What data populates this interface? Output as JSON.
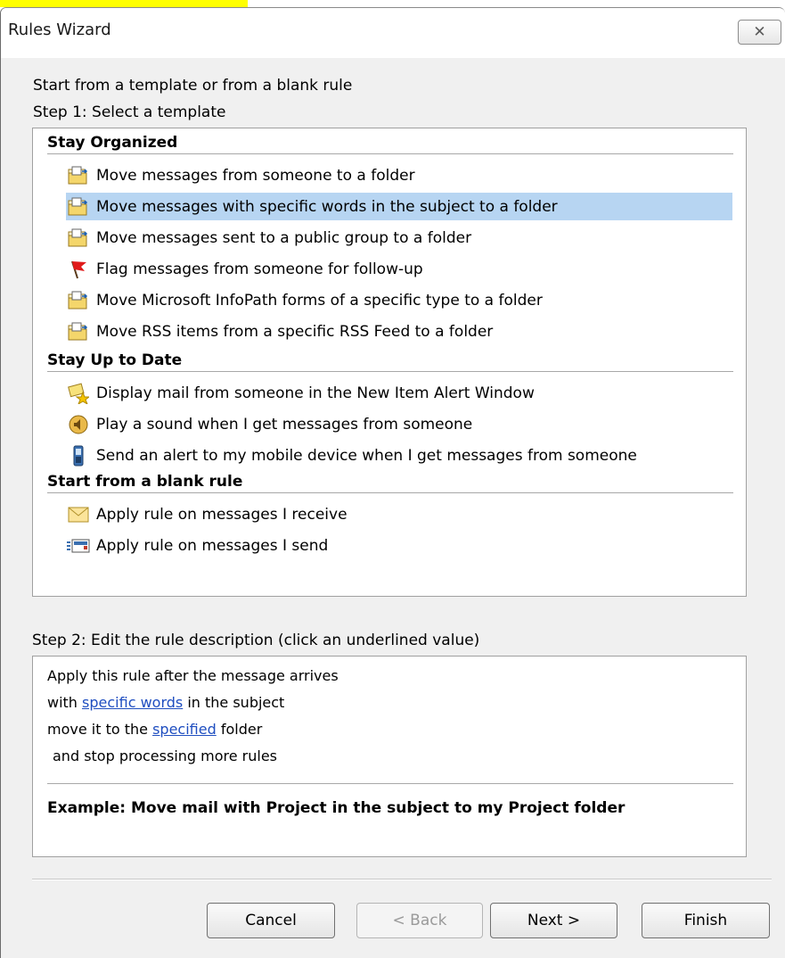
{
  "window": {
    "title": "Rules Wizard",
    "close_label": "✕"
  },
  "intro": "Start from a template or from a blank rule",
  "step1": "Step 1: Select a template",
  "groups": [
    {
      "label": "Stay Organized",
      "items": [
        {
          "label": "Move messages from someone to a folder",
          "icon": "move-to-folder-icon"
        },
        {
          "label": "Move messages with specific words in the subject to a folder",
          "icon": "move-to-folder-icon",
          "selected": true
        },
        {
          "label": "Move messages sent to a public group to a folder",
          "icon": "move-to-folder-icon"
        },
        {
          "label": "Flag messages from someone for follow-up",
          "icon": "red-flag-icon"
        },
        {
          "label": "Move Microsoft InfoPath forms of a specific type to a folder",
          "icon": "move-to-folder-icon"
        },
        {
          "label": "Move RSS items from a specific RSS Feed to a folder",
          "icon": "move-to-folder-icon"
        }
      ]
    },
    {
      "label": "Stay Up to Date",
      "items": [
        {
          "label": "Display mail from someone in the New Item Alert Window",
          "icon": "new-item-alert-icon"
        },
        {
          "label": "Play a sound when I get messages from someone",
          "icon": "sound-icon"
        },
        {
          "label": "Send an alert to my mobile device when I get messages from someone",
          "icon": "mobile-device-icon"
        }
      ]
    },
    {
      "label": "Start from a blank rule",
      "items": [
        {
          "label": "Apply rule on messages I receive",
          "icon": "envelope-icon"
        },
        {
          "label": "Apply rule on messages I send",
          "icon": "send-mail-icon"
        }
      ]
    }
  ],
  "step2": "Step 2: Edit the rule description (click an underlined value)",
  "description": {
    "line1": "Apply this rule after the message arrives",
    "line2_pre": "with ",
    "line2_link": "specific words",
    "line2_post": " in the subject",
    "line3_pre": "move it to the ",
    "line3_link": "specified",
    "line3_post": " folder",
    "line4": "and stop processing more rules",
    "example": "Example: Move mail with Project in the subject to my Project folder"
  },
  "buttons": {
    "cancel": "Cancel",
    "back": "< Back",
    "next": "Next >",
    "finish": "Finish"
  },
  "colors": {
    "selection": "#b7d5f2",
    "link": "#1f4ec0",
    "dialog_bg": "#f0f0f0",
    "highlight": "#ffff00"
  }
}
